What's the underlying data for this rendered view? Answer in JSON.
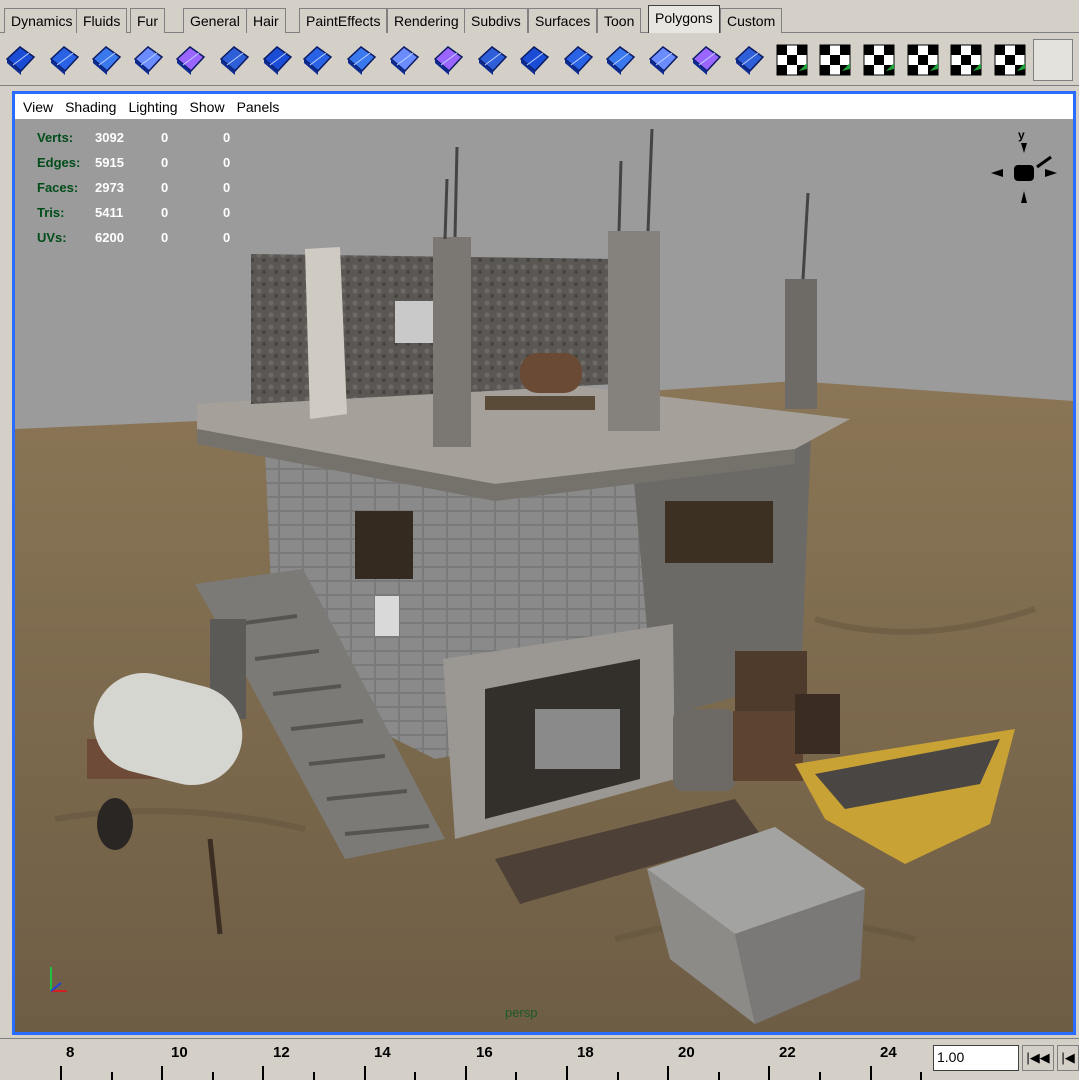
{
  "shelf_tabs": [
    {
      "label": "Dynamics",
      "active": false
    },
    {
      "label": "Fluids",
      "active": false
    },
    {
      "label": "Fur",
      "active": false
    },
    {
      "label": "General",
      "active": false
    },
    {
      "label": "Hair",
      "active": false
    },
    {
      "label": "PaintEffects",
      "active": false
    },
    {
      "label": "Rendering",
      "active": false
    },
    {
      "label": "Subdivs",
      "active": false
    },
    {
      "label": "Surfaces",
      "active": false
    },
    {
      "label": "Toon",
      "active": false
    },
    {
      "label": "Polygons",
      "active": true
    },
    {
      "label": "Custom",
      "active": false
    }
  ],
  "shelf_icons": [
    "poly-sphere-icon",
    "poly-merge-icon",
    "poly-extrude-icon",
    "poly-split-icon",
    "poly-cube-icon",
    "poly-bevel-icon",
    "poly-cut-icon",
    "poly-append-icon",
    "poly-wedge-icon",
    "poly-pyramid-icon",
    "poly-bridge-icon",
    "poly-smooth-icon",
    "poly-subdivide-icon",
    "poly-duplicate-icon",
    "poly-chamfer-icon",
    "poly-separate-icon",
    "poly-combine-icon",
    "poly-manipulator-icon",
    "uv-planar-icon",
    "uv-automatic-icon",
    "uv-cylindrical-icon",
    "uv-spherical-icon",
    "uv-layout-icon",
    "uv-editor-icon"
  ],
  "viewport": {
    "menu": [
      "View",
      "Shading",
      "Lighting",
      "Show",
      "Panels"
    ],
    "camera_name": "persp",
    "hud": [
      {
        "label": "Verts:",
        "v1": "3092",
        "v2": "0",
        "v3": "0"
      },
      {
        "label": "Edges:",
        "v1": "5915",
        "v2": "0",
        "v3": "0"
      },
      {
        "label": "Faces:",
        "v1": "2973",
        "v2": "0",
        "v3": "0"
      },
      {
        "label": "Tris:",
        "v1": "5411",
        "v2": "0",
        "v3": "0"
      },
      {
        "label": "UVs:",
        "v1": "6200",
        "v2": "0",
        "v3": "0"
      }
    ],
    "view_cube_axis": "y"
  },
  "timeline": {
    "ticks": [
      "8",
      "10",
      "12",
      "14",
      "16",
      "18",
      "20",
      "22",
      "24"
    ],
    "current_frame": "1.00",
    "rewind_button": "|◀◀",
    "step_back_button": "|◀"
  },
  "colors": {
    "accent_border": "#2a6cff",
    "ui_gray": "#d4d0c8",
    "viewport_bg": "#9b9b9b",
    "hud_label": "#004d1a"
  }
}
